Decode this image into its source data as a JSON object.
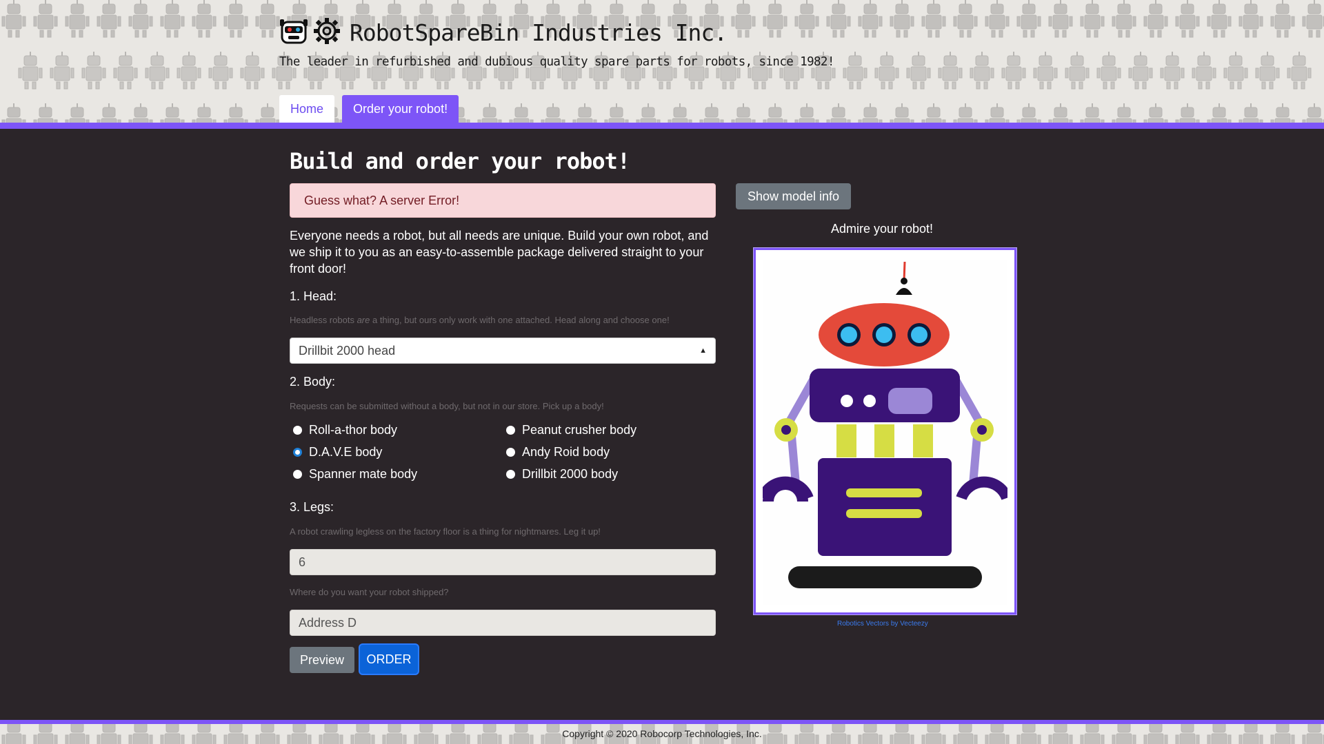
{
  "header": {
    "title": "RobotSpareBin Industries Inc.",
    "tagline": "The leader in refurbished and dubious quality spare parts for robots, since 1982!",
    "logo_icons": [
      "robot-head-icon",
      "gear-icon"
    ]
  },
  "nav": {
    "tabs": [
      {
        "label": "Home",
        "active": false
      },
      {
        "label": "Order your robot!",
        "active": true
      }
    ]
  },
  "main": {
    "title": "Build and order your robot!",
    "alert": "Guess what? A server Error!",
    "intro": "Everyone needs a robot, but all needs are unique. Build your own robot, and we ship it to you as an easy-to-assemble package delivered straight to your front door!",
    "head": {
      "label": "1. Head:",
      "help_before": "Headless robots ",
      "help_em": "are",
      "help_after": " a thing, but ours only work with one attached. Head along and choose one!",
      "selected": "Drillbit 2000 head"
    },
    "body": {
      "label": "2. Body:",
      "help": "Requests can be submitted without a body, but not in our store. Pick up a body!",
      "options": [
        {
          "label": "Roll-a-thor body",
          "checked": false
        },
        {
          "label": "Peanut crusher body",
          "checked": false
        },
        {
          "label": "D.A.V.E body",
          "checked": true
        },
        {
          "label": "Andy Roid body",
          "checked": false
        },
        {
          "label": "Spanner mate body",
          "checked": false
        },
        {
          "label": "Drillbit 2000 body",
          "checked": false
        }
      ]
    },
    "legs": {
      "label": "3. Legs:",
      "help": "A robot crawling legless on the factory floor is a thing for nightmares. Leg it up!",
      "value": "6"
    },
    "address": {
      "help": "Where do you want your robot shipped?",
      "value": "Address D"
    },
    "buttons": {
      "preview": "Preview",
      "order": "ORDER"
    }
  },
  "preview": {
    "model_info_button": "Show model info",
    "admire": "Admire your robot!",
    "credit": "Robotics Vectors by Vecteezy"
  },
  "footer": {
    "copyright": "Copyright © 2020 Robocorp Technologies, Inc."
  },
  "colors": {
    "accent": "#7d55f7",
    "background": "#2b2529",
    "alert_bg": "#f8d7da",
    "alert_text": "#721c24",
    "order_button": "#0b63d8",
    "secondary_button": "#6c757d"
  }
}
